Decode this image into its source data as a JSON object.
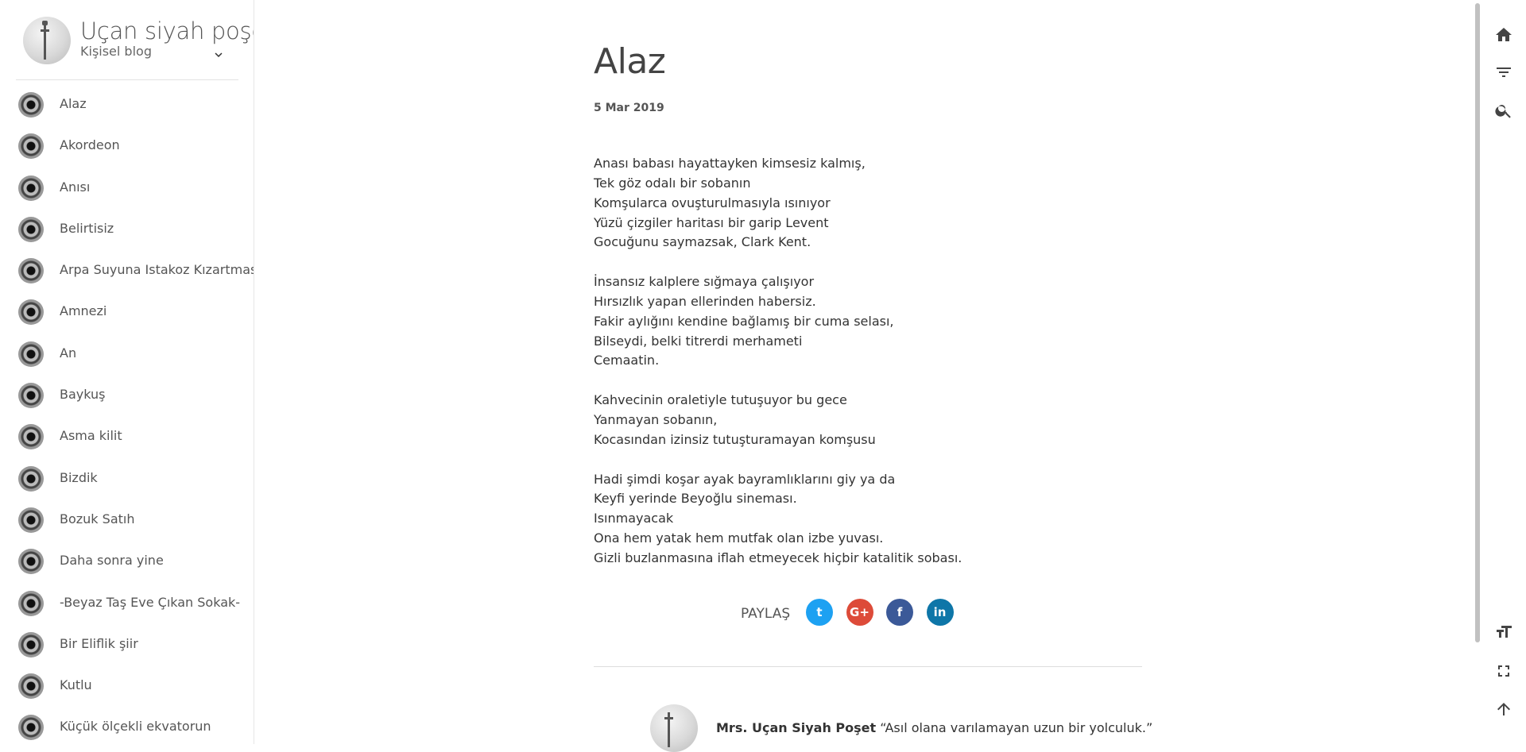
{
  "site": {
    "title": "Uçan siyah poşet",
    "subtitle": "Kişisel blog"
  },
  "nav": {
    "items": [
      {
        "label": "Alaz"
      },
      {
        "label": "Akordeon"
      },
      {
        "label": "Anısı"
      },
      {
        "label": "Belirtisiz"
      },
      {
        "label": "Arpa Suyuna Istakoz Kızartması"
      },
      {
        "label": "Amnezi"
      },
      {
        "label": "An"
      },
      {
        "label": "Baykuş"
      },
      {
        "label": "Asma kilit"
      },
      {
        "label": "Bizdik"
      },
      {
        "label": "Bozuk Satıh"
      },
      {
        "label": "Daha sonra yine"
      },
      {
        "label": "-Beyaz Taş Eve Çıkan Sokak-"
      },
      {
        "label": "Bir Eliflik şiir"
      },
      {
        "label": "Kutlu"
      },
      {
        "label": "Küçük ölçekli ekvatorun"
      }
    ]
  },
  "post": {
    "title": "Alaz",
    "date": "5 Mar 2019",
    "stanzas": [
      [
        "Anası babası hayattayken kimsesiz kalmış,",
        "Tek göz odalı bir sobanın",
        "Komşularca ovuşturulmasıyla ısınıyor",
        "Yüzü çizgiler haritası bir garip Levent",
        "Gocuğunu saymazsak, Clark Kent."
      ],
      [
        "İnsansız kalplere sığmaya çalışıyor",
        "Hırsızlık yapan ellerinden habersiz.",
        "Fakir aylığını kendine bağlamış bir cuma selası,",
        "Bilseydi, belki titrerdi merhameti",
        "Cemaatin."
      ],
      [
        "Kahvecinin oraletiyle tutuşuyor bu gece",
        "Yanmayan sobanın,",
        "Kocasından izinsiz tutuşturamayan komşusu"
      ],
      [
        "Hadi şimdi koşar ayak bayramlıklarını giy ya da",
        "Keyfi yerinde Beyoğlu sineması.",
        "Isınmayacak",
        "Ona hem yatak hem mutfak olan izbe yuvası.",
        "Gizli buzlanmasına iflah etmeyecek hiçbir katalitik sobası."
      ]
    ]
  },
  "share": {
    "label": "PAYLAŞ",
    "buttons": [
      {
        "name": "twitter",
        "icon": "twitter-icon",
        "glyph": "t",
        "color": "#1da1f2"
      },
      {
        "name": "google-plus",
        "icon": "google-plus-icon",
        "glyph": "G+",
        "color": "#dd4b39"
      },
      {
        "name": "facebook",
        "icon": "facebook-icon",
        "glyph": "f",
        "color": "#3b5998"
      },
      {
        "name": "linkedin",
        "icon": "linkedin-icon",
        "glyph": "in",
        "color": "#0e76a8"
      }
    ]
  },
  "author": {
    "name": "Mrs. Uçan Siyah Poşet",
    "quote": "“Asıl olana varılamayan uzun bir yolculuk.”"
  },
  "toolbar": {
    "icons": [
      "home-icon",
      "filter-icon",
      "search-icon",
      "font-size-icon",
      "fullscreen-icon",
      "arrow-up-icon"
    ]
  }
}
